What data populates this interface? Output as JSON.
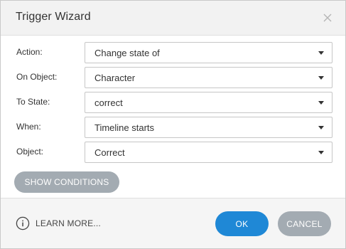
{
  "window": {
    "title": "Trigger Wizard"
  },
  "fields": [
    {
      "label": "Action:",
      "value": "Change state of"
    },
    {
      "label": "On Object:",
      "value": "Character"
    },
    {
      "label": "To State:",
      "value": "correct"
    },
    {
      "label": "When:",
      "value": "Timeline starts"
    },
    {
      "label": "Object:",
      "value": "Correct"
    }
  ],
  "show_conditions_label": "SHOW CONDITIONS",
  "footer": {
    "learn_more_label": "LEARN MORE...",
    "ok_label": "OK",
    "cancel_label": "CANCEL"
  },
  "icons": {
    "close": "close-icon",
    "caret": "chevron-down-icon",
    "info": "info-icon"
  },
  "colors": {
    "primary": "#1f88d6",
    "secondary": "#a3abb2",
    "titlebar": "#f2f2f2"
  }
}
